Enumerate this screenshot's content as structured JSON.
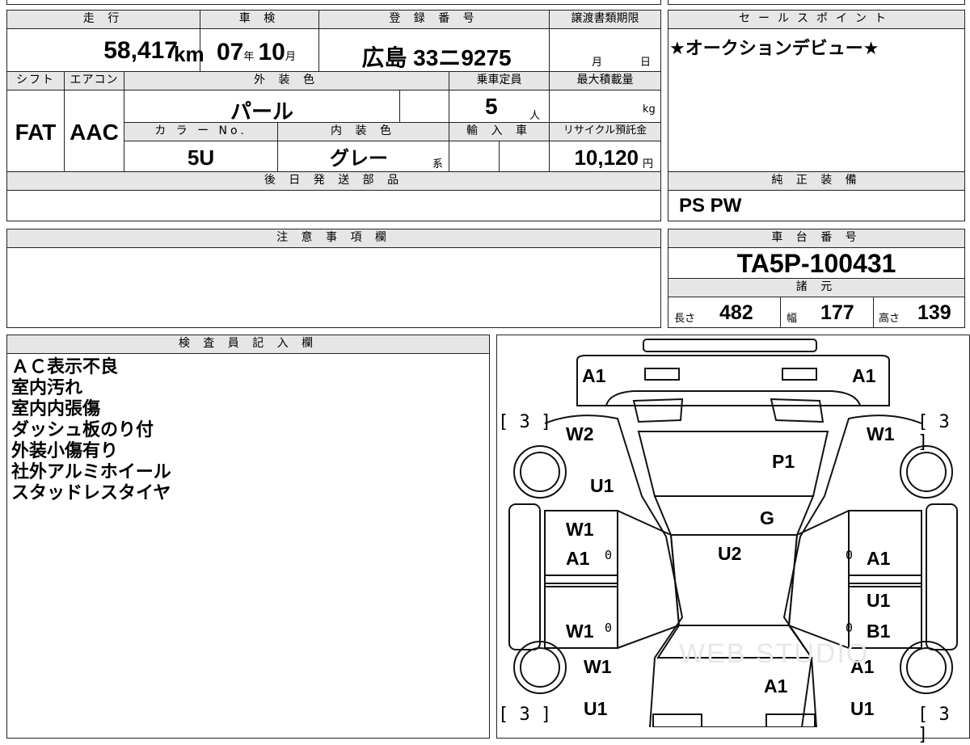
{
  "top": {
    "mileage_hdr": "走 行",
    "mileage_val": "58,417",
    "mileage_unit": "km",
    "inspection_hdr": "車 検",
    "inspect_year": "07",
    "inspect_year_unit": "年",
    "inspect_month": "10",
    "inspect_month_unit": "月",
    "reg_hdr": "登 録 番 号",
    "reg_val": "広島 33ニ9275",
    "transfer_hdr": "譲渡書類期限",
    "transfer_month": "月",
    "transfer_day": "日"
  },
  "sales": {
    "hdr": "セールスポイント",
    "text": "★オークションデビュー★"
  },
  "spec": {
    "shift_hdr": "シフト",
    "shift_val": "FAT",
    "ac_hdr": "エアコン",
    "ac_val": "AAC",
    "ext_color_hdr": "外 装 色",
    "ext_color_val": "パール",
    "capacity_hdr": "乗車定員",
    "capacity_val": "5",
    "capacity_unit": "人",
    "maxload_hdr": "最大積載量",
    "maxload_unit": "kg",
    "colorno_hdr": "カ ラ ー No.",
    "colorno_val": "5U",
    "int_color_hdr": "内 装 色",
    "int_color_val": "グレー",
    "int_color_suffix": "系",
    "import_hdr": "輸 入 車",
    "recycle_hdr": "リサイクル預託金",
    "recycle_val": "10,120",
    "recycle_unit": "円"
  },
  "later_parts": {
    "hdr": "後 日 発 送 部 品"
  },
  "equipment": {
    "hdr": "純 正 装 備",
    "val": "PS PW"
  },
  "caution": {
    "hdr": "注 意 事 項 欄"
  },
  "chassis": {
    "hdr": "車 台 番 号",
    "val": "TA5P-100431",
    "dims_hdr": "諸 元",
    "len_lbl": "長さ",
    "len_val": "482",
    "wid_lbl": "幅",
    "wid_val": "177",
    "hgt_lbl": "高さ",
    "hgt_val": "139"
  },
  "inspector": {
    "hdr": "検 査 員 記 入 欄",
    "notes": [
      "ＡＣ表示不良",
      "室内汚れ",
      "室内内張傷",
      "ダッシュ板のり付",
      "外装小傷有り",
      "社外アルミホイール",
      "スタッドレスタイヤ"
    ]
  },
  "diagram": {
    "bracket_fl": "[ 3 ]",
    "bracket_fr": "[ 3 ]",
    "bracket_rl": "[ 3 ]",
    "bracket_rr": "[ 3 ]",
    "front_left": "A1",
    "front_right": "A1",
    "fender_left": "W2",
    "fender_right": "W1",
    "hood": "P1",
    "left_u1": "U1",
    "windshield": "G",
    "roof": "U2",
    "fl_door_1": "W1",
    "fl_door_2": "A1",
    "fr_door": "A1",
    "rr_door_1": "U1",
    "rr_door_2": "B1",
    "rl_door": "W1",
    "rear_fender_left": "W1",
    "rear_fender_right": "A1",
    "trunk": "A1",
    "rear_left_u1": "U1",
    "rear_right_u1": "U1",
    "zero_1": "0",
    "zero_2": "0",
    "zero_3": "0",
    "zero_4": "0",
    "watermark": "WEB STUDIO"
  }
}
